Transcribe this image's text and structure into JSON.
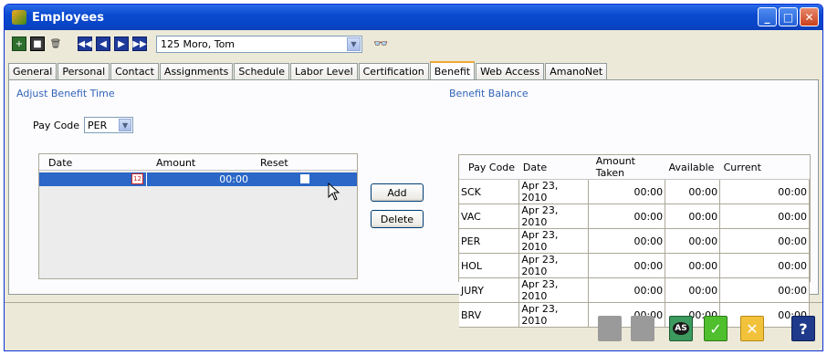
{
  "window": {
    "title": "Employees"
  },
  "window_controls": {
    "minimize": "_",
    "maximize": "□",
    "close": "✕"
  },
  "toolbar": {
    "employee_select": "125 Moro, Tom",
    "icons": [
      "add-icon",
      "save-icon",
      "trash-icon",
      "first-record-icon",
      "prev-record-icon",
      "next-record-icon",
      "last-record-icon",
      "binoculars-icon"
    ]
  },
  "tabs": [
    {
      "label": "General"
    },
    {
      "label": "Personal"
    },
    {
      "label": "Contact"
    },
    {
      "label": "Assignments"
    },
    {
      "label": "Schedule"
    },
    {
      "label": "Labor Level"
    },
    {
      "label": "Certification"
    },
    {
      "label": "Benefit"
    },
    {
      "label": "Web Access"
    },
    {
      "label": "AmanoNet"
    }
  ],
  "active_tab": "Benefit",
  "adjust": {
    "title": "Adjust Benefit Time",
    "pay_code_label": "Pay Code",
    "pay_code_value": "PER",
    "columns": [
      "Date",
      "Amount",
      "Reset"
    ],
    "edit_row": {
      "date": "",
      "amount": "00:00",
      "reset": false
    },
    "add_label": "Add",
    "delete_label": "Delete"
  },
  "balance": {
    "title": "Benefit Balance",
    "columns": [
      "Pay Code",
      "Date",
      "Amount Taken",
      "Available",
      "Current"
    ],
    "rows": [
      [
        "SCK",
        "Apr 23, 2010",
        "00:00",
        "00:00",
        "00:00"
      ],
      [
        "VAC",
        "Apr 23, 2010",
        "00:00",
        "00:00",
        "00:00"
      ],
      [
        "PER",
        "Apr 23, 2010",
        "00:00",
        "00:00",
        "00:00"
      ],
      [
        "HOL",
        "Apr 23, 2010",
        "00:00",
        "00:00",
        "00:00"
      ],
      [
        "JURY",
        "Apr 23, 2010",
        "00:00",
        "00:00",
        "00:00"
      ],
      [
        "BRV",
        "Apr 23, 2010",
        "00:00",
        "00:00",
        "00:00"
      ]
    ]
  },
  "bottom_buttons": [
    {
      "name": "disabled-button-1",
      "icon": "blank-icon"
    },
    {
      "name": "disabled-button-2",
      "icon": "blank-icon"
    },
    {
      "name": "save-as-button",
      "icon": "save-as-icon",
      "label": "AS"
    },
    {
      "name": "ok-button",
      "icon": "checkmark-icon"
    },
    {
      "name": "cancel-button",
      "icon": "x-icon"
    },
    {
      "name": "help-button",
      "icon": "help-icon",
      "label": "?"
    }
  ],
  "colors": {
    "titlebar": "#0a4ad0",
    "selection": "#2a67c6",
    "section_title": "#3264b8",
    "ok": "#4fbf2e",
    "cancel": "#f2c23b"
  }
}
